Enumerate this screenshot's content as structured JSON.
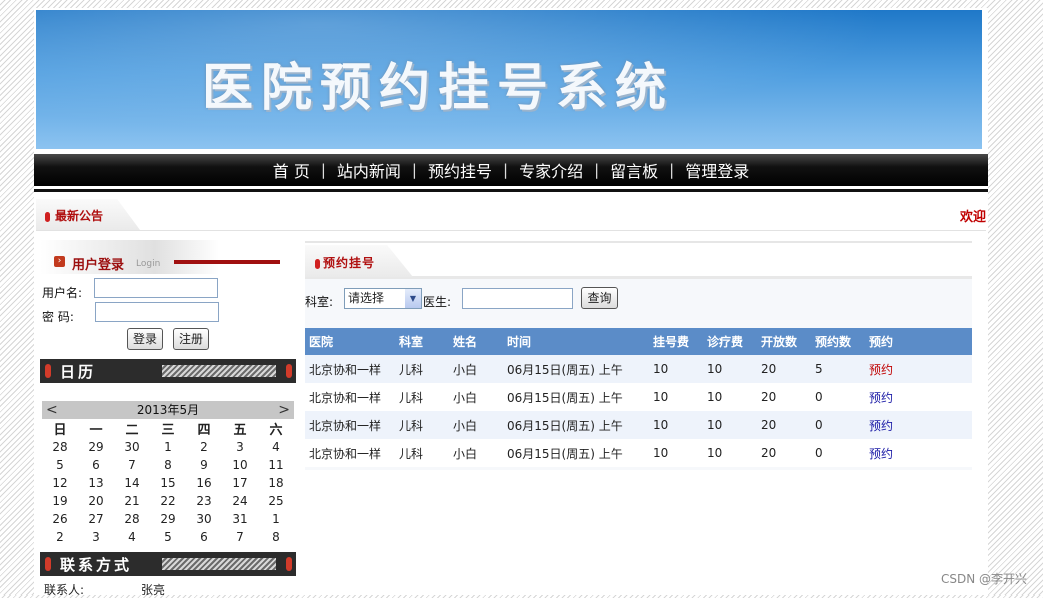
{
  "banner": {
    "title": "医院预约挂号系统"
  },
  "nav": {
    "items": [
      "首 页",
      "站内新闻",
      "预约挂号",
      "专家介绍",
      "留言板",
      "管理登录"
    ],
    "separator": "|"
  },
  "notice": {
    "label": "最新公告",
    "welcome": "欢迎"
  },
  "login": {
    "title": "用户登录",
    "subtitle": "Login",
    "username_label": "用户名:",
    "password_label": "密 码:",
    "username_value": "",
    "password_value": "",
    "login_button": "登录",
    "register_button": "注册"
  },
  "calendar": {
    "title": "日历",
    "month_label": "2013年5月",
    "prev": "<",
    "next": ">",
    "weekdays": [
      "日",
      "一",
      "二",
      "三",
      "四",
      "五",
      "六"
    ],
    "weeks": [
      [
        "28",
        "29",
        "30",
        "1",
        "2",
        "3",
        "4"
      ],
      [
        "5",
        "6",
        "7",
        "8",
        "9",
        "10",
        "11"
      ],
      [
        "12",
        "13",
        "14",
        "15",
        "16",
        "17",
        "18"
      ],
      [
        "19",
        "20",
        "21",
        "22",
        "23",
        "24",
        "25"
      ],
      [
        "26",
        "27",
        "28",
        "29",
        "30",
        "31",
        "1"
      ],
      [
        "2",
        "3",
        "4",
        "5",
        "6",
        "7",
        "8"
      ]
    ]
  },
  "contact": {
    "title": "联系方式",
    "person_label": "联系人:",
    "person_value": "张亮"
  },
  "booking": {
    "title": "预约挂号",
    "dept_label": "科室:",
    "dept_selected": "请选择",
    "doctor_label": "医生:",
    "doctor_value": "",
    "search_button": "查询",
    "columns": [
      "医院",
      "科室",
      "姓名",
      "时间",
      "挂号费",
      "诊疗费",
      "开放数",
      "预约数",
      "预约"
    ],
    "rows": [
      [
        "北京协和一样",
        "儿科",
        "小白",
        "06月15日(周五) 上午",
        "10",
        "10",
        "20",
        "5",
        "预约"
      ],
      [
        "北京协和一样",
        "儿科",
        "小白",
        "06月15日(周五) 上午",
        "10",
        "10",
        "20",
        "0",
        "预约"
      ],
      [
        "北京协和一样",
        "儿科",
        "小白",
        "06月15日(周五) 上午",
        "10",
        "10",
        "20",
        "0",
        "预约"
      ],
      [
        "北京协和一样",
        "儿科",
        "小白",
        "06月15日(周五) 上午",
        "10",
        "10",
        "20",
        "0",
        "预约"
      ]
    ],
    "link_colors": [
      "#c00000",
      "#1a1aa6",
      "#1a1aa6",
      "#1a1aa6"
    ]
  },
  "watermark": "CSDN @李开兴"
}
